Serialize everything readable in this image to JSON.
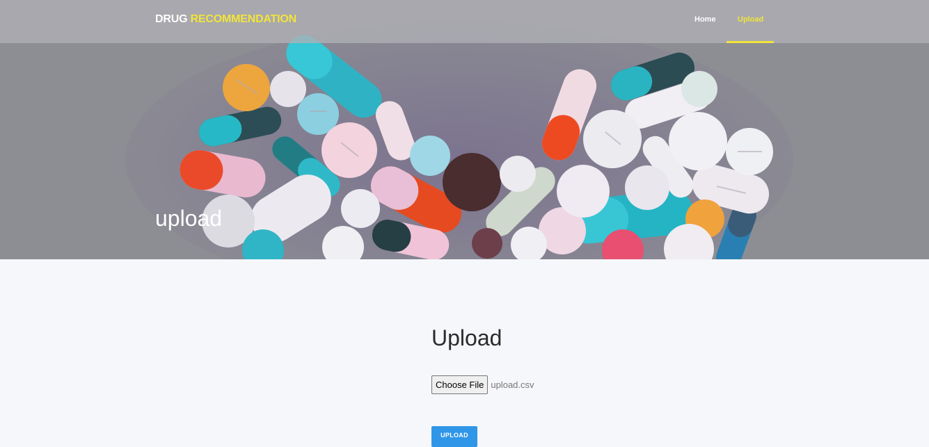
{
  "navbar": {
    "brand_primary": "DRUG",
    "brand_accent": "RECOMMENDATION",
    "links": [
      {
        "label": "Home",
        "active": false
      },
      {
        "label": "Upload",
        "active": true
      }
    ]
  },
  "hero": {
    "title": "upload"
  },
  "main": {
    "heading": "Upload",
    "file_input": {
      "button_label": "Choose File",
      "file_name": "upload.csv"
    },
    "submit_label": "UPLOAD"
  },
  "colors": {
    "accent_yellow": "#f2e43a",
    "primary_blue": "#2f96e8",
    "page_background": "#f6f7fb"
  }
}
